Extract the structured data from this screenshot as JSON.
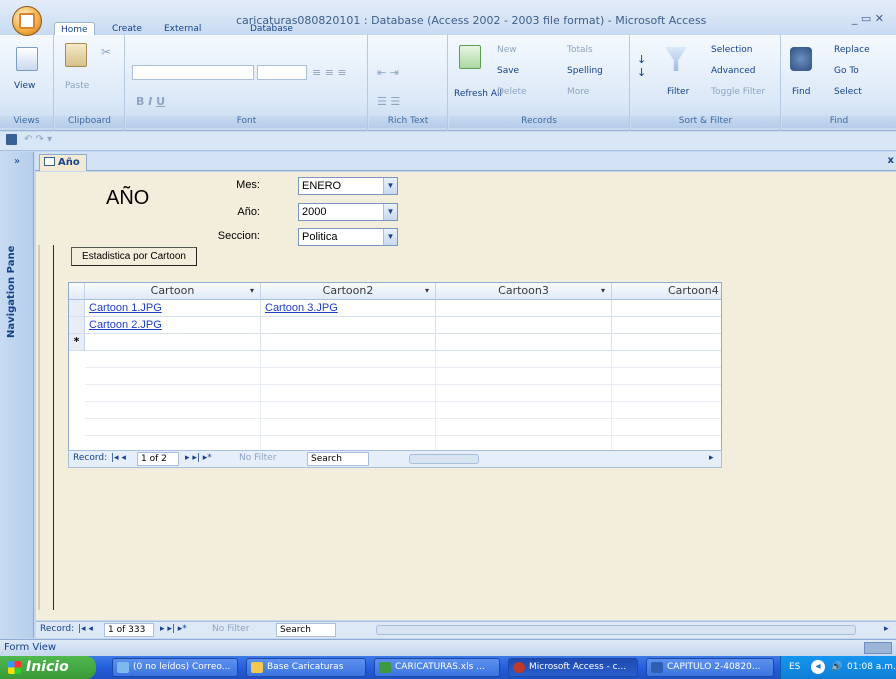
{
  "window": {
    "title": "caricaturas080820101 : Database (Access 2002 - 2003 file format) - Microsoft Access",
    "controls": "_ ▭ ✕"
  },
  "ribbon_tabs": [
    "Home",
    "Create",
    "External Data",
    "Database Tools"
  ],
  "ribbon": {
    "views": {
      "view": "View",
      "label": "Views"
    },
    "clipboard": {
      "paste": "Paste",
      "label": "Clipboard"
    },
    "font": {
      "label": "Font"
    },
    "rich_text": {
      "label": "Rich Text"
    },
    "records": {
      "refresh": "Refresh All",
      "new": "New",
      "save": "Save",
      "delete": "Delete",
      "totals": "Totals",
      "spelling": "Spelling",
      "more": "More",
      "label": "Records"
    },
    "sort_filter": {
      "filter": "Filter",
      "selection": "Selection",
      "advanced": "Advanced",
      "toggle": "Toggle Filter",
      "label": "Sort & Filter"
    },
    "find": {
      "find": "Find",
      "replace": "Replace",
      "goto": "Go To",
      "select": "Select",
      "label": "Find"
    }
  },
  "navigation_pane": {
    "label": "Navigation Pane",
    "toggle": "»"
  },
  "doc_tab": {
    "label": "Año",
    "close": "x"
  },
  "form": {
    "title": "AÑO",
    "fields": [
      {
        "label": "Mes:",
        "value": "ENERO"
      },
      {
        "label": "Año:",
        "value": "2000"
      },
      {
        "label": "Seccion:",
        "value": "Politica"
      }
    ],
    "button": "Estadistica por Cartoon"
  },
  "datasheet": {
    "columns": [
      "Cartoon",
      "Cartoon2",
      "Cartoon3",
      "Cartoon4"
    ],
    "rows": [
      [
        "Cartoon 1.JPG",
        "Cartoon 3.JPG",
        "",
        ""
      ],
      [
        "Cartoon 2.JPG",
        "",
        "",
        ""
      ]
    ],
    "new_row_marker": "*",
    "record_nav": {
      "label": "Record:",
      "position": "1 of 2",
      "filter": "No Filter",
      "search": "Search"
    }
  },
  "form_record_nav": {
    "label": "Record:",
    "position": "1 of 333",
    "filter": "No Filter",
    "search": "Search"
  },
  "status": {
    "text": "Form View"
  },
  "taskbar": {
    "start": "Inicio",
    "tasks": [
      "(0 no leídos) Correo...",
      "Base Caricaturas",
      "CARICATURAS.xls ...",
      "Microsoft Access - c...",
      "CAPITULO 2-40820..."
    ],
    "lang": "ES",
    "clock": "01:08 a.m."
  }
}
